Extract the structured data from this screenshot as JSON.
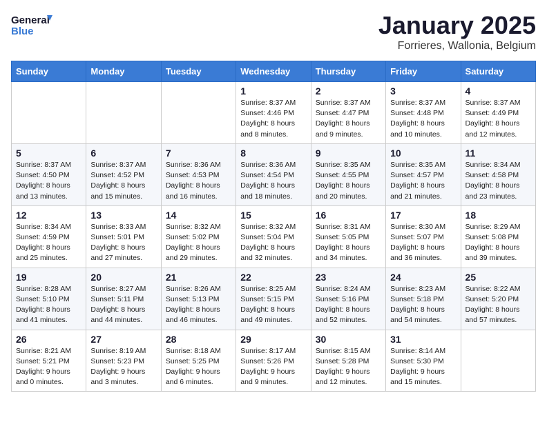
{
  "header": {
    "logo_line1": "General",
    "logo_line2": "Blue",
    "month": "January 2025",
    "location": "Forrieres, Wallonia, Belgium"
  },
  "weekdays": [
    "Sunday",
    "Monday",
    "Tuesday",
    "Wednesday",
    "Thursday",
    "Friday",
    "Saturday"
  ],
  "weeks": [
    [
      {
        "day": "",
        "info": ""
      },
      {
        "day": "",
        "info": ""
      },
      {
        "day": "",
        "info": ""
      },
      {
        "day": "1",
        "info": "Sunrise: 8:37 AM\nSunset: 4:46 PM\nDaylight: 8 hours\nand 8 minutes."
      },
      {
        "day": "2",
        "info": "Sunrise: 8:37 AM\nSunset: 4:47 PM\nDaylight: 8 hours\nand 9 minutes."
      },
      {
        "day": "3",
        "info": "Sunrise: 8:37 AM\nSunset: 4:48 PM\nDaylight: 8 hours\nand 10 minutes."
      },
      {
        "day": "4",
        "info": "Sunrise: 8:37 AM\nSunset: 4:49 PM\nDaylight: 8 hours\nand 12 minutes."
      }
    ],
    [
      {
        "day": "5",
        "info": "Sunrise: 8:37 AM\nSunset: 4:50 PM\nDaylight: 8 hours\nand 13 minutes."
      },
      {
        "day": "6",
        "info": "Sunrise: 8:37 AM\nSunset: 4:52 PM\nDaylight: 8 hours\nand 15 minutes."
      },
      {
        "day": "7",
        "info": "Sunrise: 8:36 AM\nSunset: 4:53 PM\nDaylight: 8 hours\nand 16 minutes."
      },
      {
        "day": "8",
        "info": "Sunrise: 8:36 AM\nSunset: 4:54 PM\nDaylight: 8 hours\nand 18 minutes."
      },
      {
        "day": "9",
        "info": "Sunrise: 8:35 AM\nSunset: 4:55 PM\nDaylight: 8 hours\nand 20 minutes."
      },
      {
        "day": "10",
        "info": "Sunrise: 8:35 AM\nSunset: 4:57 PM\nDaylight: 8 hours\nand 21 minutes."
      },
      {
        "day": "11",
        "info": "Sunrise: 8:34 AM\nSunset: 4:58 PM\nDaylight: 8 hours\nand 23 minutes."
      }
    ],
    [
      {
        "day": "12",
        "info": "Sunrise: 8:34 AM\nSunset: 4:59 PM\nDaylight: 8 hours\nand 25 minutes."
      },
      {
        "day": "13",
        "info": "Sunrise: 8:33 AM\nSunset: 5:01 PM\nDaylight: 8 hours\nand 27 minutes."
      },
      {
        "day": "14",
        "info": "Sunrise: 8:32 AM\nSunset: 5:02 PM\nDaylight: 8 hours\nand 29 minutes."
      },
      {
        "day": "15",
        "info": "Sunrise: 8:32 AM\nSunset: 5:04 PM\nDaylight: 8 hours\nand 32 minutes."
      },
      {
        "day": "16",
        "info": "Sunrise: 8:31 AM\nSunset: 5:05 PM\nDaylight: 8 hours\nand 34 minutes."
      },
      {
        "day": "17",
        "info": "Sunrise: 8:30 AM\nSunset: 5:07 PM\nDaylight: 8 hours\nand 36 minutes."
      },
      {
        "day": "18",
        "info": "Sunrise: 8:29 AM\nSunset: 5:08 PM\nDaylight: 8 hours\nand 39 minutes."
      }
    ],
    [
      {
        "day": "19",
        "info": "Sunrise: 8:28 AM\nSunset: 5:10 PM\nDaylight: 8 hours\nand 41 minutes."
      },
      {
        "day": "20",
        "info": "Sunrise: 8:27 AM\nSunset: 5:11 PM\nDaylight: 8 hours\nand 44 minutes."
      },
      {
        "day": "21",
        "info": "Sunrise: 8:26 AM\nSunset: 5:13 PM\nDaylight: 8 hours\nand 46 minutes."
      },
      {
        "day": "22",
        "info": "Sunrise: 8:25 AM\nSunset: 5:15 PM\nDaylight: 8 hours\nand 49 minutes."
      },
      {
        "day": "23",
        "info": "Sunrise: 8:24 AM\nSunset: 5:16 PM\nDaylight: 8 hours\nand 52 minutes."
      },
      {
        "day": "24",
        "info": "Sunrise: 8:23 AM\nSunset: 5:18 PM\nDaylight: 8 hours\nand 54 minutes."
      },
      {
        "day": "25",
        "info": "Sunrise: 8:22 AM\nSunset: 5:20 PM\nDaylight: 8 hours\nand 57 minutes."
      }
    ],
    [
      {
        "day": "26",
        "info": "Sunrise: 8:21 AM\nSunset: 5:21 PM\nDaylight: 9 hours\nand 0 minutes."
      },
      {
        "day": "27",
        "info": "Sunrise: 8:19 AM\nSunset: 5:23 PM\nDaylight: 9 hours\nand 3 minutes."
      },
      {
        "day": "28",
        "info": "Sunrise: 8:18 AM\nSunset: 5:25 PM\nDaylight: 9 hours\nand 6 minutes."
      },
      {
        "day": "29",
        "info": "Sunrise: 8:17 AM\nSunset: 5:26 PM\nDaylight: 9 hours\nand 9 minutes."
      },
      {
        "day": "30",
        "info": "Sunrise: 8:15 AM\nSunset: 5:28 PM\nDaylight: 9 hours\nand 12 minutes."
      },
      {
        "day": "31",
        "info": "Sunrise: 8:14 AM\nSunset: 5:30 PM\nDaylight: 9 hours\nand 15 minutes."
      },
      {
        "day": "",
        "info": ""
      }
    ]
  ]
}
